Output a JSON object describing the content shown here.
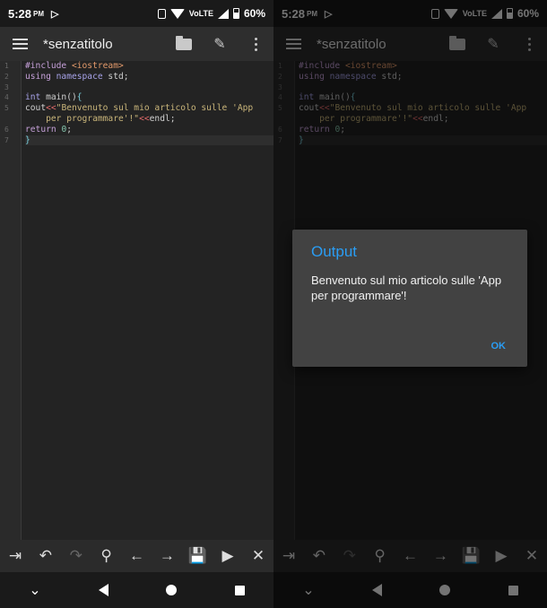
{
  "status": {
    "time": "5:28",
    "ampm": "PM",
    "volte": "VoLTE",
    "battery": "60%"
  },
  "app": {
    "title": "*senzatitolo"
  },
  "editor": {
    "line_numbers": [
      "1",
      "2",
      "3",
      "4",
      "5",
      "",
      "6",
      "7"
    ],
    "lines": {
      "l1a": "#include ",
      "l1b": "<iostream>",
      "l2a": "using ",
      "l2b": "namespace",
      "l2c": " std;",
      "l4a": "int",
      "l4b": " main()",
      "l4c": "{",
      "l5a": "cout",
      "l5b": "<<",
      "l5c": "\"Benvenuto sul mio articolo sulle 'App",
      "l5d": "    per programmare'!\"",
      "l5e": "<<",
      "l5f": "endl;",
      "l6a": "return ",
      "l6b": "0",
      "l6c": ";",
      "l7a": "}"
    }
  },
  "toolbar": {
    "tab": "⇥",
    "undo": "↶",
    "redo": "↷",
    "search": "⚲",
    "left": "←",
    "right": "→",
    "save": "💾",
    "run": "▶",
    "close": "✕"
  },
  "nav": {
    "down": "⌄"
  },
  "dialog": {
    "title": "Output",
    "message": "Benvenuto sul mio articolo sulle 'App per programmare'!",
    "ok": "OK"
  },
  "colors": {
    "accent": "#2a9df4",
    "background": "#1e1e1e"
  }
}
